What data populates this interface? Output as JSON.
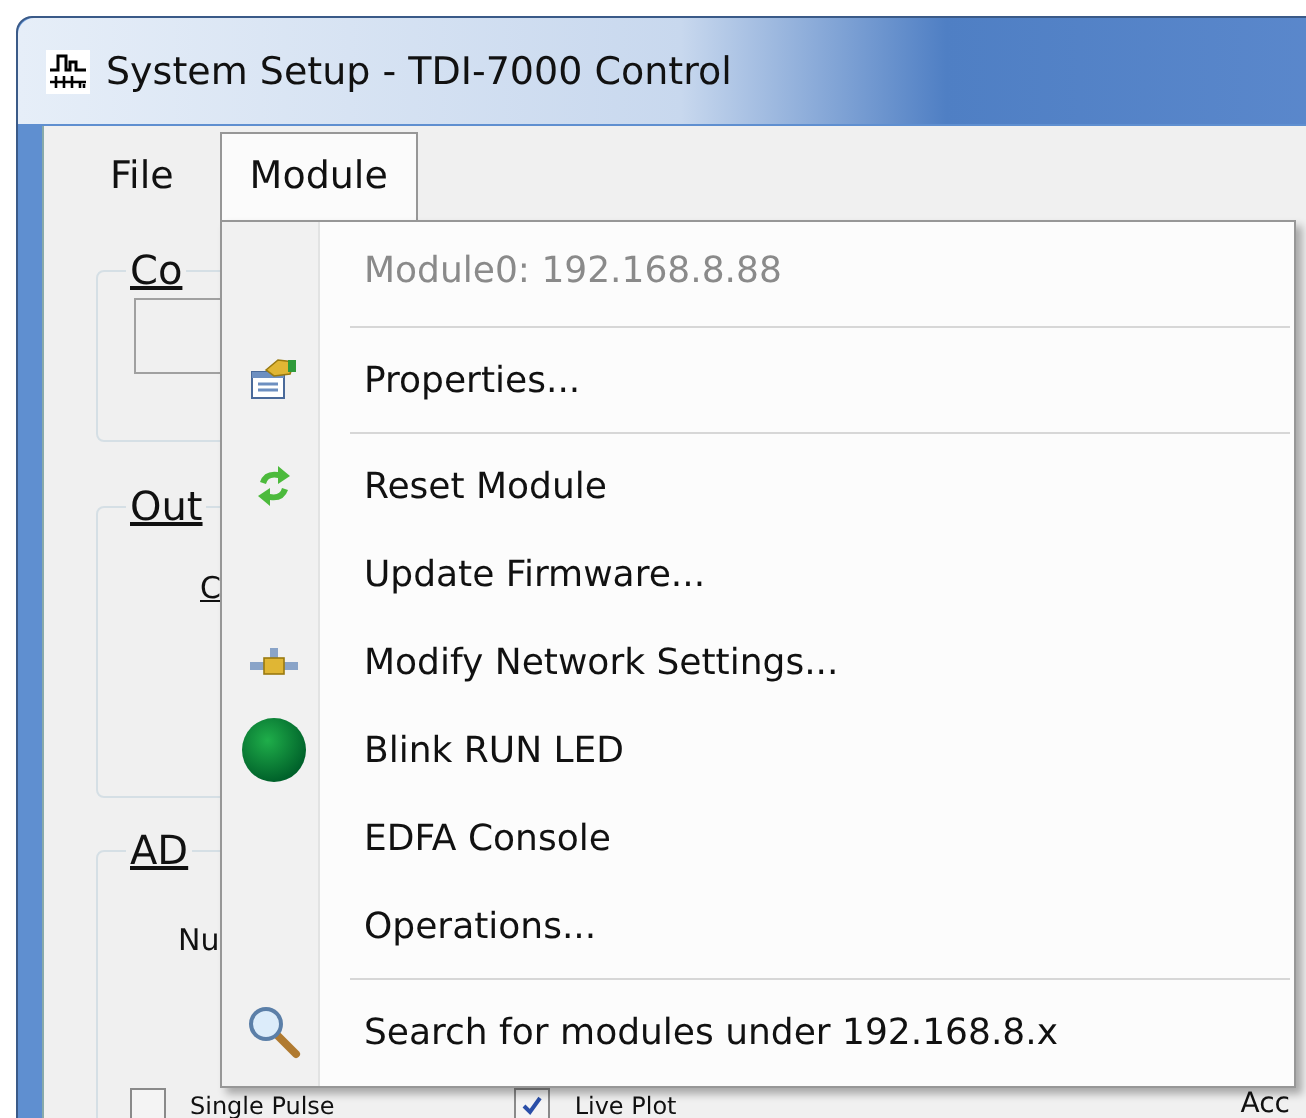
{
  "window": {
    "title": "System Setup - TDI-7000 Control"
  },
  "menu_bar": [
    {
      "label": "File",
      "selected": false
    },
    {
      "label": "Module",
      "selected": true
    }
  ],
  "groups": [
    {
      "label": "Co",
      "text_field": true
    },
    {
      "label": "Out",
      "text": "C"
    },
    {
      "label": "AD",
      "text": "Nu"
    }
  ],
  "checkboxes": [
    {
      "label": "Single Pulse",
      "checked": false
    },
    {
      "label": "Live Plot",
      "checked": true
    }
  ],
  "column_3_text": "Acc",
  "dropdown": [
    {
      "kind": "item",
      "label": "Module0:  192.168.8.88",
      "disabled": true
    },
    {
      "kind": "separator"
    },
    {
      "kind": "item",
      "label": "Properties...",
      "disabled": false
    },
    {
      "kind": "separator"
    },
    {
      "kind": "item",
      "label": "Reset Module",
      "disabled": false
    },
    {
      "kind": "item",
      "label": "Update Firmware...",
      "disabled": false
    },
    {
      "kind": "item",
      "label": "Modify Network Settings...",
      "disabled": false
    },
    {
      "kind": "item",
      "label": "Blink RUN LED",
      "disabled": false
    },
    {
      "kind": "item",
      "label": "EDFA Console",
      "disabled": false
    },
    {
      "kind": "item",
      "label": "Operations...",
      "disabled": false
    },
    {
      "kind": "separator"
    },
    {
      "kind": "item",
      "label": "Search for modules under 192.168.8.x",
      "disabled": false
    }
  ]
}
